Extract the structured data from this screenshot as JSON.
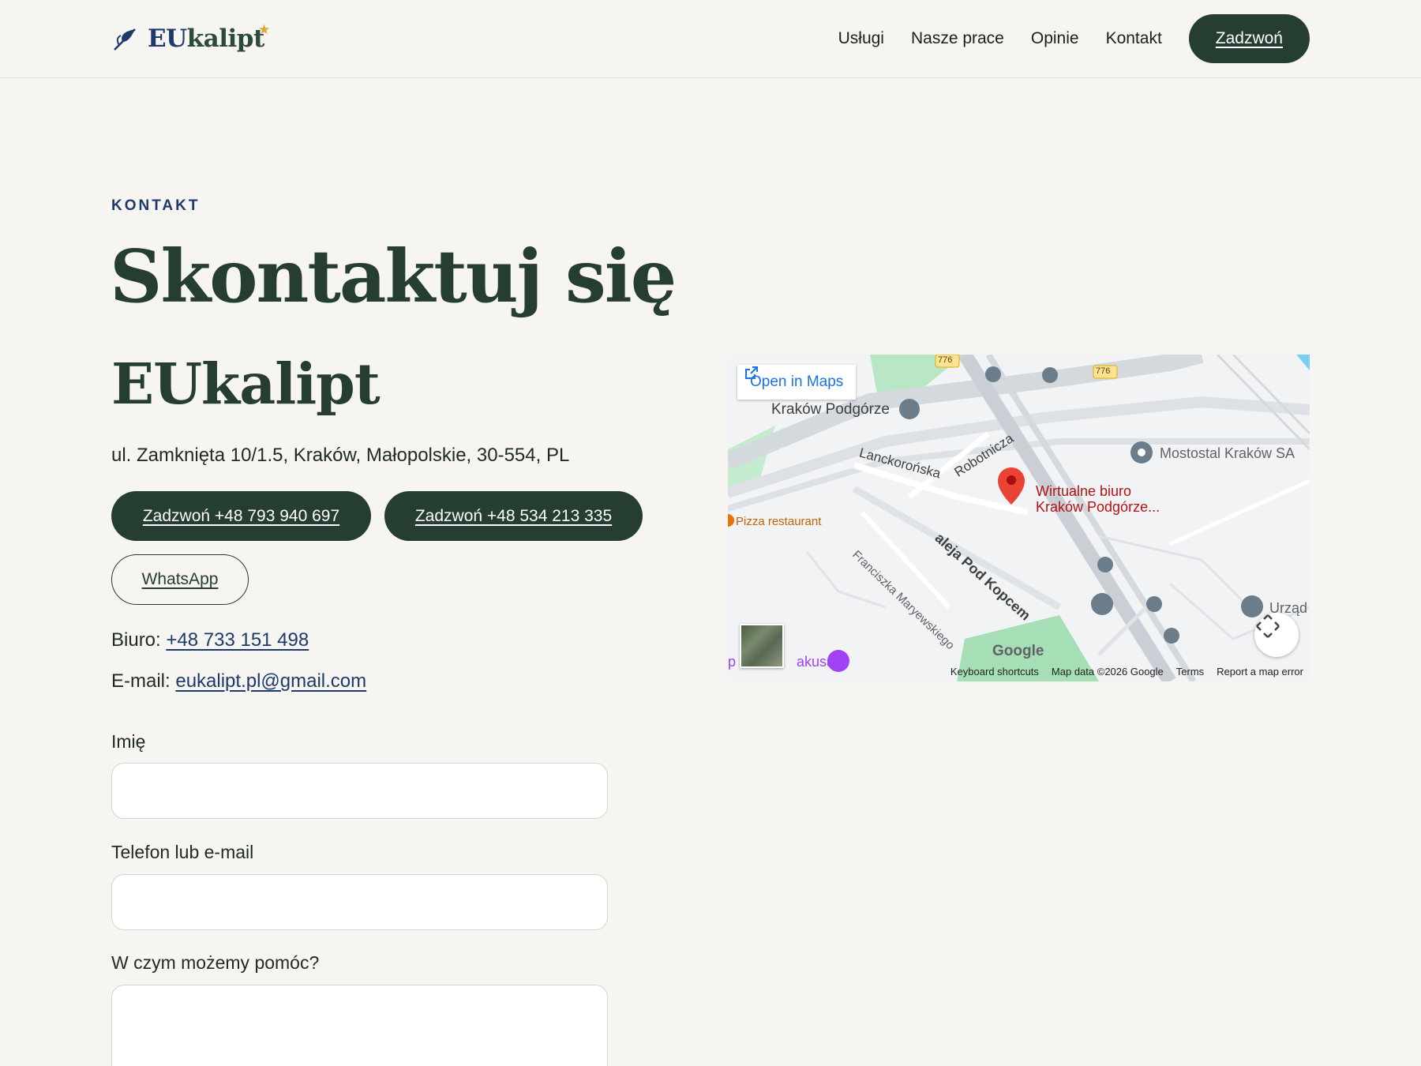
{
  "header": {
    "logo_prefix": "EU",
    "logo_rest": "kalipt",
    "logo_star": "★",
    "nav": [
      "Usługi",
      "Nasze prace",
      "Opinie",
      "Kontakt"
    ],
    "call_label": "Zadzwoń"
  },
  "hero": {
    "eyebrow": "KONTAKT",
    "title_line1": "Skontaktuj się",
    "title_line2": "EUkalipt",
    "address": "ul. Zamknięta 10/1.5, Kraków, Małopolskie, 30-554, PL",
    "call_button_1": "Zadzwoń +48 793 940 697",
    "call_button_2": "Zadzwoń +48 534 213 335",
    "whatsapp_label": "WhatsApp",
    "office_label": "Biuro:",
    "office_phone": "+48 733 151 498",
    "email_label": "E-mail:",
    "email": "eukalipt.pl@gmail.com"
  },
  "form": {
    "name_label": "Imię",
    "contact_label": "Telefon lub e-mail",
    "message_label": "W czym możemy pomóc?"
  },
  "map": {
    "open_label": "Open in Maps",
    "labels": {
      "station": "Kraków Podgórze",
      "street1": "Lanckorońska",
      "street2": "Robotnicza",
      "street3": "Franciszka Maryewskiego",
      "street4": "aleja Pod Kopcem",
      "company": "Mostostal Kraków SA",
      "pin_line1": "Wirtualne biuro",
      "pin_line2": "Kraków Podgórze...",
      "pizza": "Pizza restaurant",
      "place_partial": "akusa",
      "place_partial_left": "p",
      "office_partial": "Urząd",
      "road_a": "776",
      "road_b": "776",
      "google": "Google"
    },
    "footer": [
      "Keyboard shortcuts",
      "Map data ©2026 Google",
      "Terms",
      "Report a map error"
    ]
  },
  "colors": {
    "accent": "#263d32",
    "brand_blue": "#1e3a6b",
    "star": "#e0a52b",
    "background": "#f6f5f1"
  }
}
